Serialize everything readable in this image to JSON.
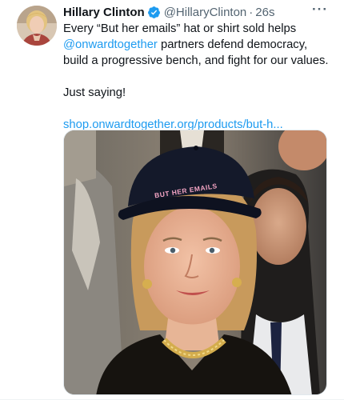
{
  "tweet": {
    "author_name": "Hillary Clinton",
    "handle": "@HillaryClinton",
    "separator": "·",
    "time": "26s",
    "more_label": "···",
    "line1_pre": "Every “But her emails” hat or shirt sold helps",
    "mention": "@onwardtogether",
    "line2_post": " partners defend democracy,",
    "line3": "build a progressive bench, and fight for our values.",
    "line4": "Just saying!",
    "link": "shop.onwardtogether.org/products/but-h..."
  },
  "media": {
    "hat_text": "BUT HER EMAILS"
  },
  "icons": {
    "verified": "verified-badge-icon",
    "more": "more-options-icon"
  },
  "colors": {
    "accent": "#1d9bf0",
    "secondary_text": "#536471",
    "primary_text": "#0f1419"
  }
}
